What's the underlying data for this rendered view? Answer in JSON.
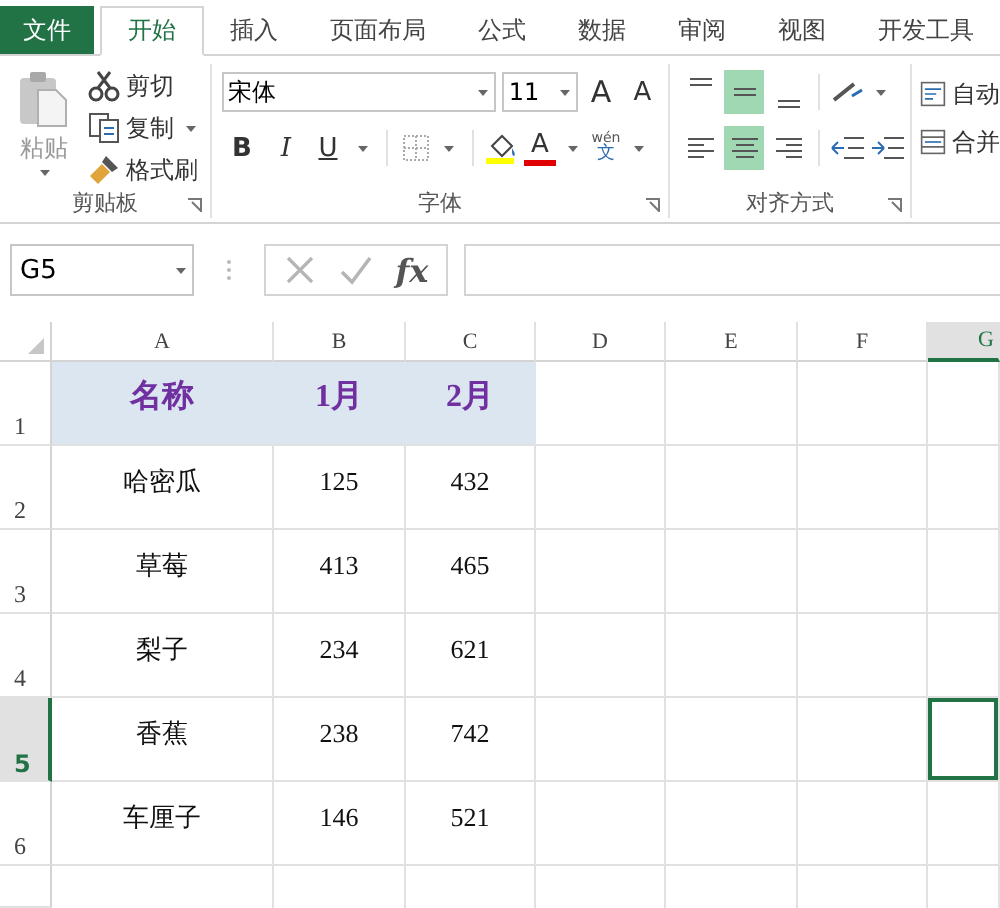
{
  "tabs": [
    {
      "label": "文件",
      "kind": "file",
      "selected": false
    },
    {
      "label": "开始",
      "kind": "normal",
      "selected": true
    },
    {
      "label": "插入",
      "kind": "normal",
      "selected": false
    },
    {
      "label": "页面布局",
      "kind": "normal",
      "selected": false
    },
    {
      "label": "公式",
      "kind": "normal",
      "selected": false
    },
    {
      "label": "数据",
      "kind": "normal",
      "selected": false
    },
    {
      "label": "审阅",
      "kind": "normal",
      "selected": false
    },
    {
      "label": "视图",
      "kind": "normal",
      "selected": false
    },
    {
      "label": "开发工具",
      "kind": "normal",
      "selected": false
    }
  ],
  "clipboard": {
    "paste": "粘贴",
    "cut": "剪切",
    "copy": "复制",
    "format_painter": "格式刷",
    "label": "剪贴板"
  },
  "font": {
    "font_name": "宋体",
    "font_size": "11",
    "grow": "A",
    "shrink": "A",
    "bold": "B",
    "italic": "I",
    "underline": "U",
    "font_color": "A",
    "phonetic_top": "wén",
    "phonetic_bottom": "文",
    "label": "字体"
  },
  "alignment": {
    "vertical": [
      {
        "kind": "top",
        "selected": false
      },
      {
        "kind": "middle",
        "selected": true
      },
      {
        "kind": "bottom",
        "selected": false
      }
    ],
    "horizontal": [
      {
        "kind": "left",
        "selected": false
      },
      {
        "kind": "center",
        "selected": true
      },
      {
        "kind": "right",
        "selected": false
      }
    ],
    "wrap": "自动",
    "merge": "合并",
    "label": "对齐方式"
  },
  "formula_bar": {
    "name_box": "G5",
    "fx": "fx"
  },
  "sheet": {
    "columns": [
      {
        "label": "A",
        "selected": false
      },
      {
        "label": "B",
        "selected": false
      },
      {
        "label": "C",
        "selected": false
      },
      {
        "label": "D",
        "selected": false
      },
      {
        "label": "E",
        "selected": false
      },
      {
        "label": "F",
        "selected": false
      },
      {
        "label": "G",
        "selected": true
      }
    ],
    "rows": [
      {
        "number": "1",
        "kind": "header",
        "selected": false,
        "cells": [
          "名称",
          "1月",
          "2月"
        ]
      },
      {
        "number": "2",
        "kind": "data",
        "selected": false,
        "cells": [
          "哈密瓜",
          "125",
          "432"
        ]
      },
      {
        "number": "3",
        "kind": "data",
        "selected": false,
        "cells": [
          "草莓",
          "413",
          "465"
        ]
      },
      {
        "number": "4",
        "kind": "data",
        "selected": false,
        "cells": [
          "梨子",
          "234",
          "621"
        ]
      },
      {
        "number": "5",
        "kind": "data",
        "selected": true,
        "cells": [
          "香蕉",
          "238",
          "742"
        ]
      },
      {
        "number": "6",
        "kind": "data",
        "selected": false,
        "cells": [
          "车厘子",
          "146",
          "521"
        ]
      }
    ]
  }
}
